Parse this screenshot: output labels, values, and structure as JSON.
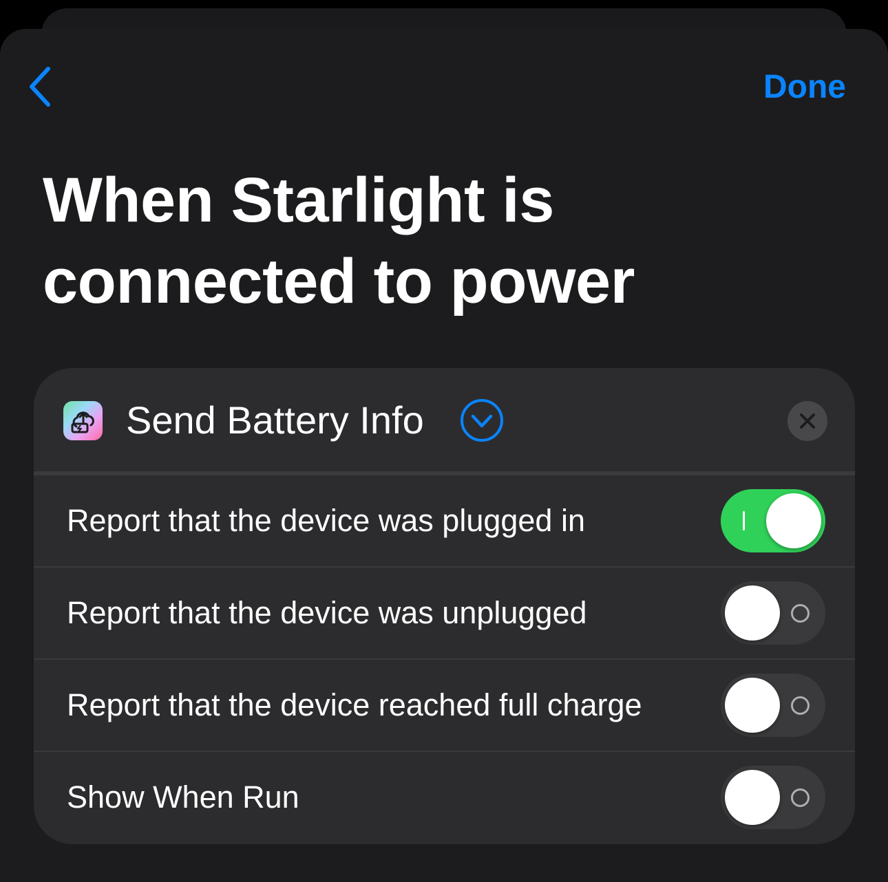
{
  "nav": {
    "done_label": "Done",
    "back_icon": "chevron-left-icon"
  },
  "page": {
    "title": "When Starlight is connected to power"
  },
  "action": {
    "title": "Send Battery Info",
    "app_icon": "battery-cloud-upload-icon",
    "expand_icon": "chevron-down-circle-icon",
    "remove_icon": "close-icon",
    "parameters": [
      {
        "label": "Report that the device was plugged in",
        "enabled": true
      },
      {
        "label": "Report that the device was unplugged",
        "enabled": false
      },
      {
        "label": "Report that the device reached full charge",
        "enabled": false
      },
      {
        "label": "Show When Run",
        "enabled": false
      }
    ]
  },
  "colors": {
    "accent": "#0a84ff",
    "toggle_on": "#30d158",
    "toggle_off": "#3a3a3c",
    "sheet_background": "#1c1c1e",
    "card_background": "#2c2c2e"
  }
}
